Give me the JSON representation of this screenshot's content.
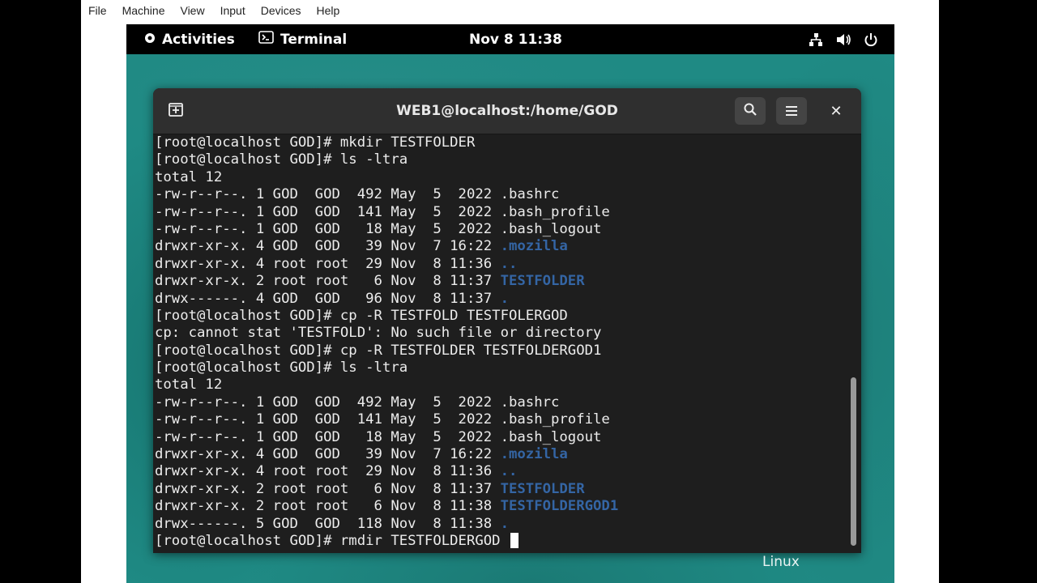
{
  "host_menu": [
    "File",
    "Machine",
    "View",
    "Input",
    "Devices",
    "Help"
  ],
  "topbar": {
    "activities": "Activities",
    "app_name": "Terminal",
    "clock": "Nov 8  11:38",
    "icons": [
      "network-icon",
      "volume-icon",
      "power-icon"
    ]
  },
  "terminal": {
    "title": "WEB1@localhost:/home/GOD",
    "lines": [
      {
        "text": "[root@localhost GOD]# mkdir TESTFOLDER"
      },
      {
        "text": "[root@localhost GOD]# ls -ltra"
      },
      {
        "text": "total 12"
      },
      {
        "text": "-rw-r--r--. 1 GOD  GOD  492 May  5  2022 .bashrc"
      },
      {
        "text": "-rw-r--r--. 1 GOD  GOD  141 May  5  2022 .bash_profile"
      },
      {
        "text": "-rw-r--r--. 1 GOD  GOD   18 May  5  2022 .bash_logout"
      },
      {
        "text": "drwxr-xr-x. 4 GOD  GOD   39 Nov  7 16:22 ",
        "dir": ".mozilla"
      },
      {
        "text": "drwxr-xr-x. 4 root root  29 Nov  8 11:36 ",
        "dir": ".."
      },
      {
        "text": "drwxr-xr-x. 2 root root   6 Nov  8 11:37 ",
        "dir": "TESTFOLDER"
      },
      {
        "text": "drwx------. 4 GOD  GOD   96 Nov  8 11:37 ",
        "dir": "."
      },
      {
        "text": "[root@localhost GOD]# cp -R TESTFOLD TESTFOLERGOD"
      },
      {
        "text": "cp: cannot stat 'TESTFOLD': No such file or directory"
      },
      {
        "text": "[root@localhost GOD]# cp -R TESTFOLDER TESTFOLDERGOD1"
      },
      {
        "text": "[root@localhost GOD]# ls -ltra"
      },
      {
        "text": "total 12"
      },
      {
        "text": "-rw-r--r--. 1 GOD  GOD  492 May  5  2022 .bashrc"
      },
      {
        "text": "-rw-r--r--. 1 GOD  GOD  141 May  5  2022 .bash_profile"
      },
      {
        "text": "-rw-r--r--. 1 GOD  GOD   18 May  5  2022 .bash_logout"
      },
      {
        "text": "drwxr-xr-x. 4 GOD  GOD   39 Nov  7 16:22 ",
        "dir": ".mozilla"
      },
      {
        "text": "drwxr-xr-x. 4 root root  29 Nov  8 11:36 ",
        "dir": ".."
      },
      {
        "text": "drwxr-xr-x. 2 root root   6 Nov  8 11:37 ",
        "dir": "TESTFOLDER"
      },
      {
        "text": "drwxr-xr-x. 2 root root   6 Nov  8 11:38 ",
        "dir": "TESTFOLDERGOD1"
      },
      {
        "text": "drwx------. 5 GOD  GOD  118 Nov  8 11:38 ",
        "dir": "."
      },
      {
        "text": "[root@localhost GOD]# rmdir TESTFOLDERGOD ",
        "cursor": true
      }
    ]
  },
  "watermark": "Linux",
  "colors": {
    "directory": "#3465a4",
    "terminal_bg": "#1e1e1e",
    "desktop": "#1f8a84"
  }
}
